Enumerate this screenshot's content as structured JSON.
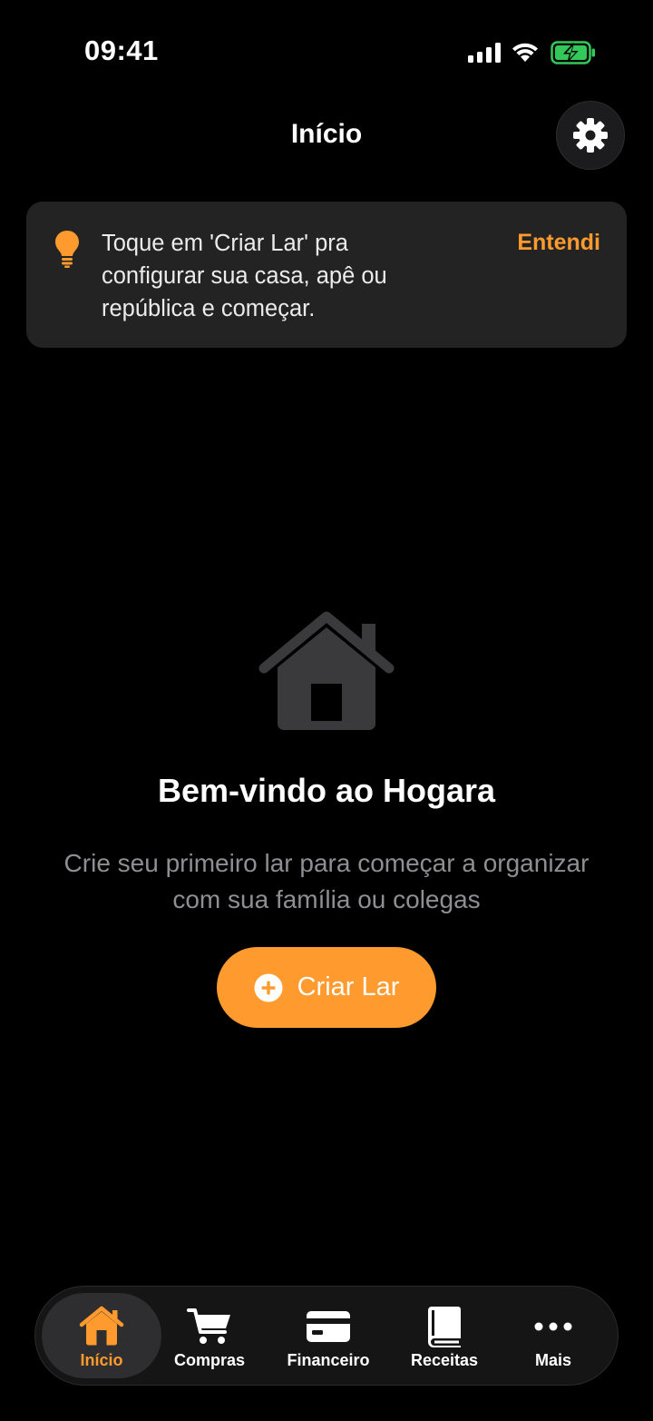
{
  "status_bar": {
    "time": "09:41",
    "icons": [
      "signal-icon",
      "wifi-icon",
      "battery-charging-icon"
    ]
  },
  "header": {
    "title": "Início",
    "settings_icon": "gear-icon"
  },
  "tip": {
    "icon": "lightbulb-icon",
    "text": "Toque em 'Criar Lar' pra configurar sua casa, apê ou república e começar.",
    "dismiss_label": "Entendi"
  },
  "empty_state": {
    "icon": "house-icon",
    "title": "Bem-vindo ao Hogara",
    "subtitle": "Crie seu primeiro lar para começar a organizar com sua família ou colegas",
    "button_label": "Criar Lar",
    "button_icon": "plus-circle-icon"
  },
  "tab_bar": {
    "items": [
      {
        "label": "Início",
        "icon": "house-icon",
        "active": true
      },
      {
        "label": "Compras",
        "icon": "cart-icon",
        "active": false
      },
      {
        "label": "Financeiro",
        "icon": "credit-card-icon",
        "active": false
      },
      {
        "label": "Receitas",
        "icon": "book-icon",
        "active": false
      },
      {
        "label": "Mais",
        "icon": "ellipsis-icon",
        "active": false
      }
    ]
  },
  "colors": {
    "background": "#000000",
    "accent": "#ff9a2e",
    "card": "#232323",
    "muted_text": "#8e8e93",
    "battery": "#34c759"
  }
}
